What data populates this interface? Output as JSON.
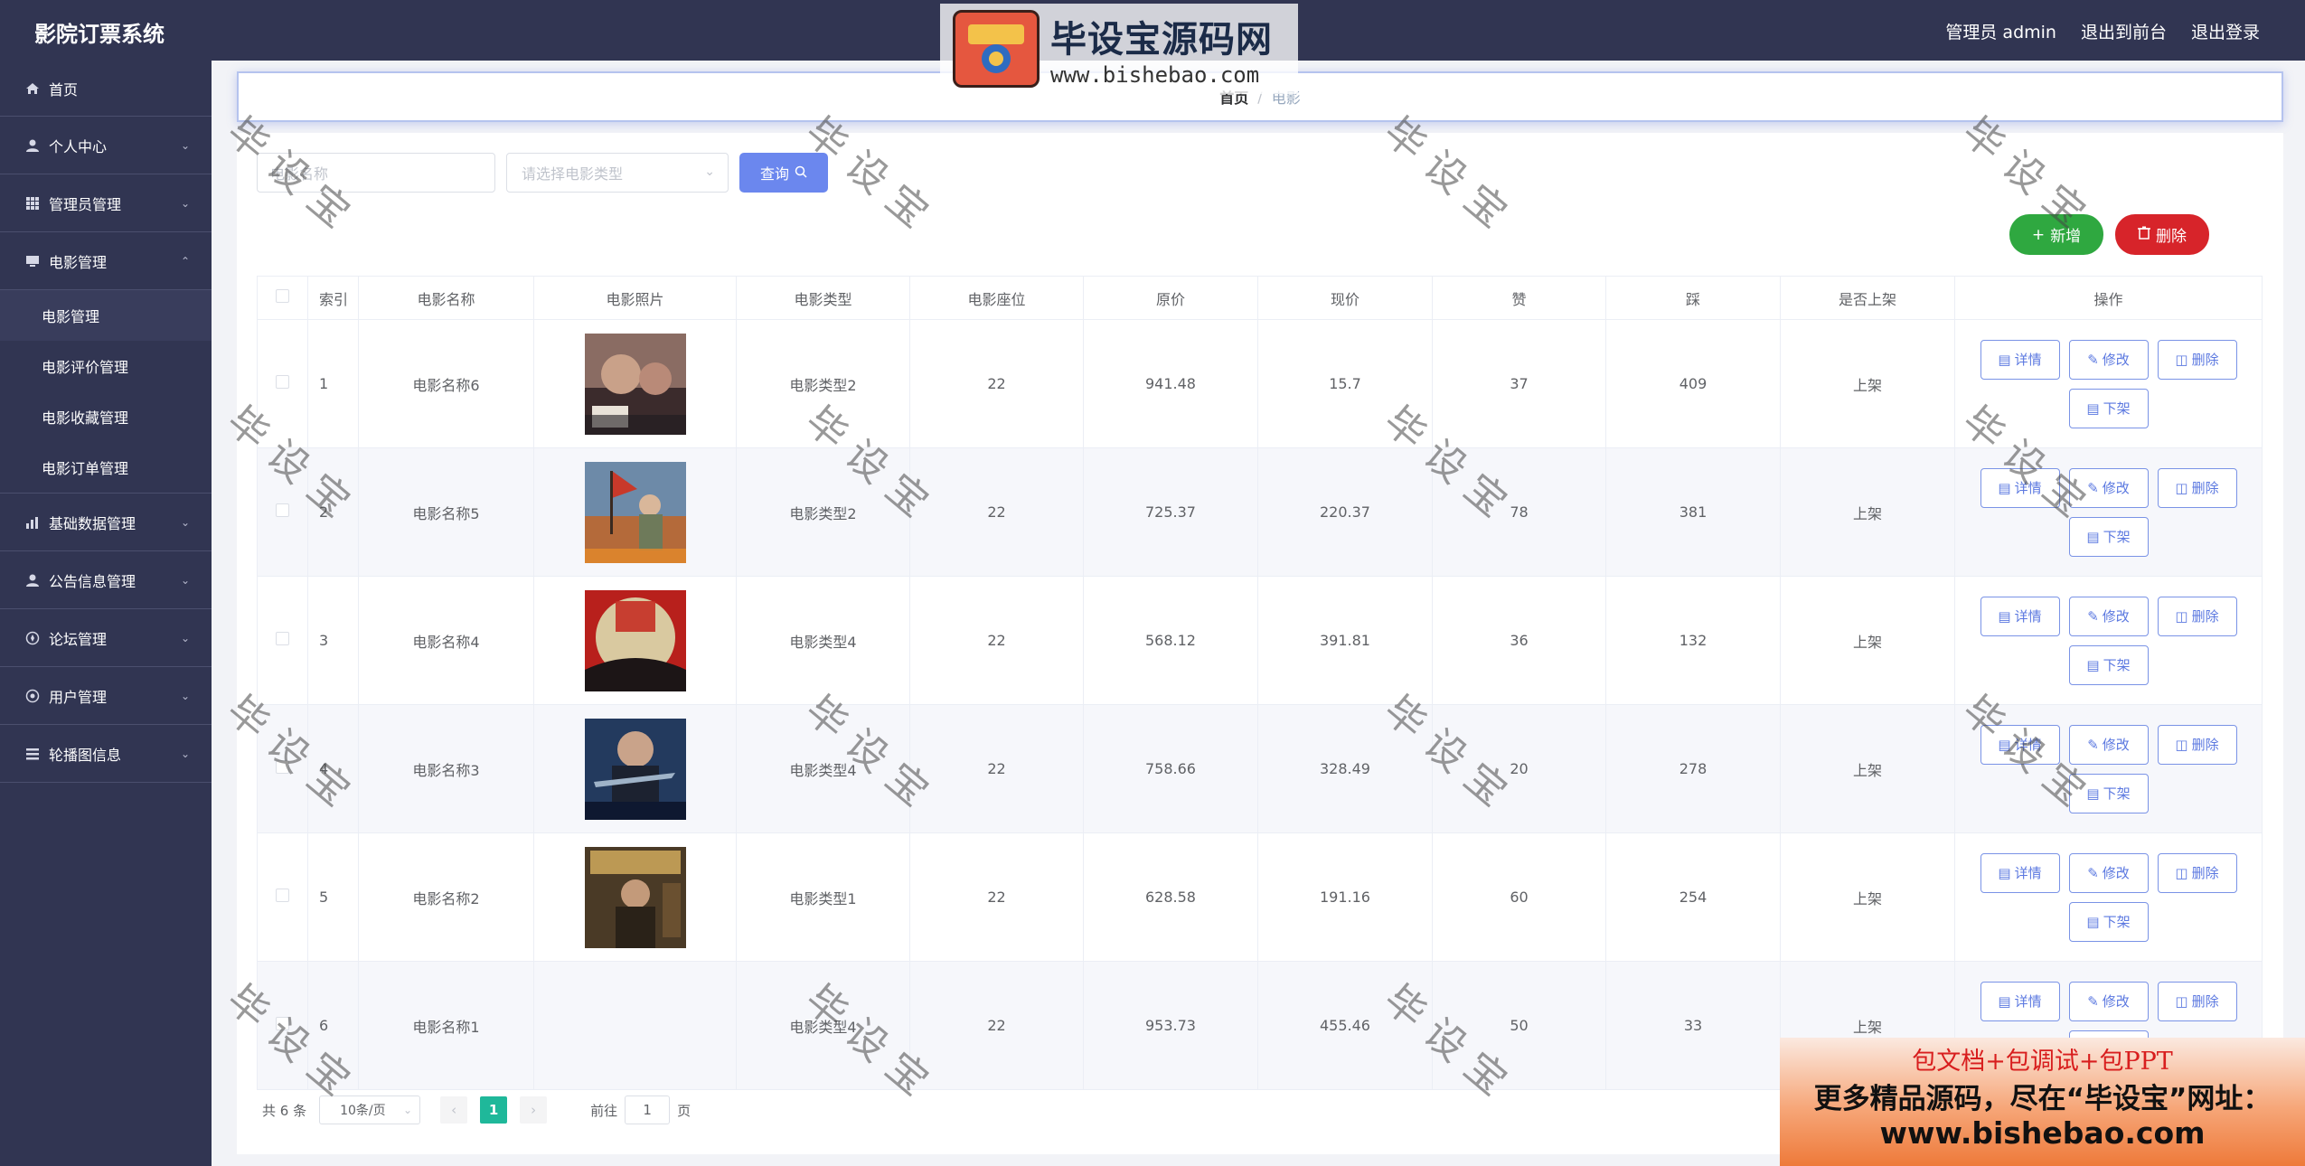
{
  "header": {
    "title": "影院订票系统",
    "user_label": "管理员 admin",
    "front_label": "退出到前台",
    "logout_label": "退出登录"
  },
  "sidebar": {
    "items": [
      {
        "label": "首页",
        "icon": "home-icon"
      },
      {
        "label": "个人中心",
        "icon": "user-icon"
      },
      {
        "label": "管理员管理",
        "icon": "grid-icon"
      },
      {
        "label": "电影管理",
        "icon": "monitor-icon"
      },
      {
        "label": "基础数据管理",
        "icon": "chart-icon"
      },
      {
        "label": "公告信息管理",
        "icon": "user-icon"
      },
      {
        "label": "论坛管理",
        "icon": "compass-icon"
      },
      {
        "label": "用户管理",
        "icon": "compass-icon"
      },
      {
        "label": "轮播图信息",
        "icon": "list-icon"
      }
    ],
    "submenu": [
      "电影管理",
      "电影评价管理",
      "电影收藏管理",
      "电影订单管理"
    ]
  },
  "breadcrumb": {
    "home": "首页",
    "separator": "/",
    "current": "电影"
  },
  "filter": {
    "name_placeholder": "电影名称",
    "type_placeholder": "请选择电影类型",
    "query_label": "查询"
  },
  "actions": {
    "add_label": "新增",
    "delete_label": "删除"
  },
  "table": {
    "headers": [
      "索引",
      "电影名称",
      "电影照片",
      "电影类型",
      "电影座位",
      "原价",
      "现价",
      "赞",
      "踩",
      "是否上架",
      "操作"
    ],
    "rows": [
      {
        "index": "1",
        "name": "电影名称6",
        "type": "电影类型2",
        "seats": "22",
        "orig": "941.48",
        "now": "15.7",
        "like": "37",
        "dislike": "409",
        "status": "上架"
      },
      {
        "index": "2",
        "name": "电影名称5",
        "type": "电影类型2",
        "seats": "22",
        "orig": "725.37",
        "now": "220.37",
        "like": "78",
        "dislike": "381",
        "status": "上架"
      },
      {
        "index": "3",
        "name": "电影名称4",
        "type": "电影类型4",
        "seats": "22",
        "orig": "568.12",
        "now": "391.81",
        "like": "36",
        "dislike": "132",
        "status": "上架"
      },
      {
        "index": "4",
        "name": "电影名称3",
        "type": "电影类型4",
        "seats": "22",
        "orig": "758.66",
        "now": "328.49",
        "like": "20",
        "dislike": "278",
        "status": "上架"
      },
      {
        "index": "5",
        "name": "电影名称2",
        "type": "电影类型1",
        "seats": "22",
        "orig": "628.58",
        "now": "191.16",
        "like": "60",
        "dislike": "254",
        "status": "上架"
      },
      {
        "index": "6",
        "name": "电影名称1",
        "type": "电影类型4",
        "seats": "22",
        "orig": "953.73",
        "now": "455.46",
        "like": "50",
        "dislike": "33",
        "status": "上架"
      }
    ],
    "op_labels": {
      "detail": "详情",
      "edit": "修改",
      "delete": "删除",
      "offshelf": "下架"
    }
  },
  "pagination": {
    "total_text": "共 6 条",
    "page_size": "10条/页",
    "current_page": "1",
    "goto_prefix": "前往",
    "goto_value": "1",
    "goto_suffix": "页"
  },
  "watermark": {
    "logo_text": "毕设宝源码网",
    "logo_url": "www.bishebao.com",
    "stamp": "毕设宝"
  },
  "promo": {
    "line1": "包文档+包调试+包PPT",
    "line2": "更多精品源码，尽在“毕设宝”网址：",
    "line3": "www.bishebao.com"
  },
  "colors": {
    "sidebar_bg": "#313552",
    "query_btn": "#6b87ee",
    "add_btn": "#2fa840",
    "delete_btn": "#d7242a",
    "page_active": "#1fb89a"
  }
}
